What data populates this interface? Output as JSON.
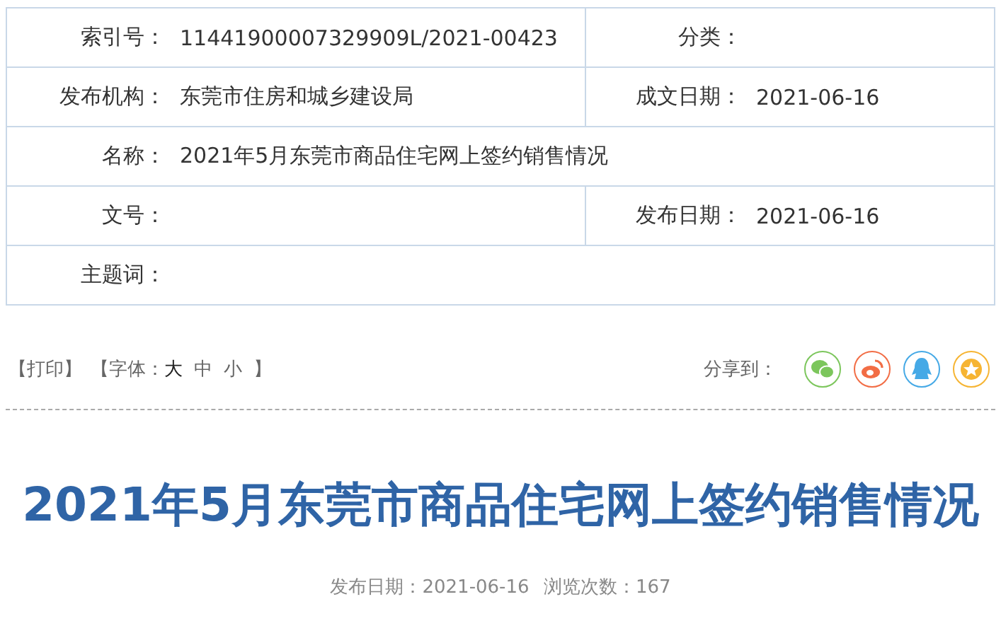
{
  "info_table": {
    "rows": [
      {
        "cells": [
          {
            "label": "索引号：",
            "value": "11441900007329909L/2021-00423"
          },
          {
            "label": "分类："
          }
        ]
      },
      {
        "cells": [
          {
            "label": "发布机构：",
            "value": "东莞市住房和城乡建设局"
          },
          {
            "label": "成文日期：",
            "value": "2021-06-16"
          }
        ]
      },
      {
        "cells": [
          {
            "label": "名称：",
            "value": "2021年5月东莞市商品住宅网上签约销售情况"
          }
        ]
      },
      {
        "cells": [
          {
            "label": "文号："
          },
          {
            "label": "发布日期：",
            "value": "2021-06-16"
          }
        ]
      },
      {
        "cells": [
          {
            "label": "主题词："
          }
        ]
      }
    ]
  },
  "toolbar": {
    "print": "【打印】",
    "font_label": "【字体：",
    "font_sizes": [
      {
        "label": "大",
        "selected": true
      },
      {
        "label": "中",
        "selected": false
      },
      {
        "label": "小",
        "selected": false
      }
    ],
    "font_close": "】",
    "share_label": "分享到：",
    "share_buttons": [
      {
        "kind": "wechat",
        "color": "#7cc65c"
      },
      {
        "kind": "weibo",
        "color": "#f26d45"
      },
      {
        "kind": "qq",
        "color": "#45a9e6"
      },
      {
        "kind": "favorite",
        "color": "#f6b432"
      }
    ]
  },
  "article": {
    "title": "2021年5月东莞市商品住宅网上签约销售情况",
    "published": "发布日期：2021-06-16",
    "views": "浏览次数：167"
  }
}
